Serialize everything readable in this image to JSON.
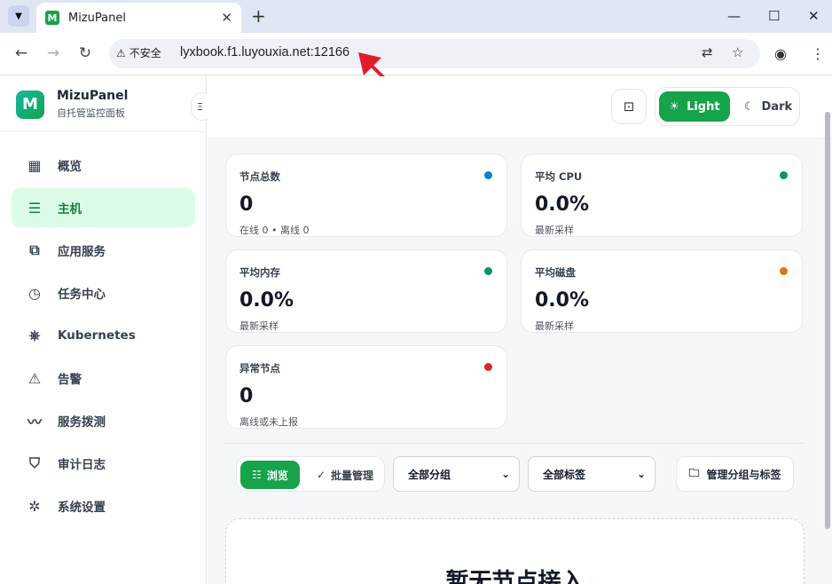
{
  "browser": {
    "tab_title": "MizuPanel",
    "favicon_letter": "M",
    "insecure_label": "不安全",
    "url": "lyxbook.f1.luyouxia.net:12166"
  },
  "sidebar": {
    "brand_name": "MizuPanel",
    "brand_subtitle": "自托管监控面板",
    "collapse_label": "Ξ",
    "items": [
      {
        "label": "概览",
        "icon": "grid-icon"
      },
      {
        "label": "主机",
        "icon": "server-icon",
        "active": true
      },
      {
        "label": "应用服务",
        "icon": "apps-icon"
      },
      {
        "label": "任务中心",
        "icon": "calendar-clock-icon"
      },
      {
        "label": "Kubernetes",
        "icon": "kubernetes-icon"
      },
      {
        "label": "告警",
        "icon": "warning-icon"
      },
      {
        "label": "服务拨测",
        "icon": "pulse-icon"
      },
      {
        "label": "审计日志",
        "icon": "shield-check-icon"
      },
      {
        "label": "系统设置",
        "icon": "gear-icon"
      }
    ]
  },
  "topbar": {
    "theme_light": "Light",
    "theme_dark": "Dark"
  },
  "cards": [
    {
      "title": "节点总数",
      "value": "0",
      "sub": "在线 0 • 离线 0",
      "dot": "#0284c7"
    },
    {
      "title": "平均 CPU",
      "value": "0.0%",
      "sub": "最新采样",
      "dot": "#059669"
    },
    {
      "title": "平均内存",
      "value": "0.0%",
      "sub": "最新采样",
      "dot": "#059669"
    },
    {
      "title": "平均磁盘",
      "value": "0.0%",
      "sub": "最新采样",
      "dot": "#d97706"
    },
    {
      "title": "异常节点",
      "value": "0",
      "sub": "离线或未上报",
      "dot": "#dc2626"
    }
  ],
  "toolbar": {
    "browse_label": "浏览",
    "batch_label": "批量管理",
    "group_select": "全部分组",
    "tag_select": "全部标签",
    "manage_label": "管理分组与标签"
  },
  "empty": {
    "title": "暂无节点接入"
  },
  "colors": {
    "accent": "#16a34a",
    "active_bg": "#dcfce7"
  }
}
